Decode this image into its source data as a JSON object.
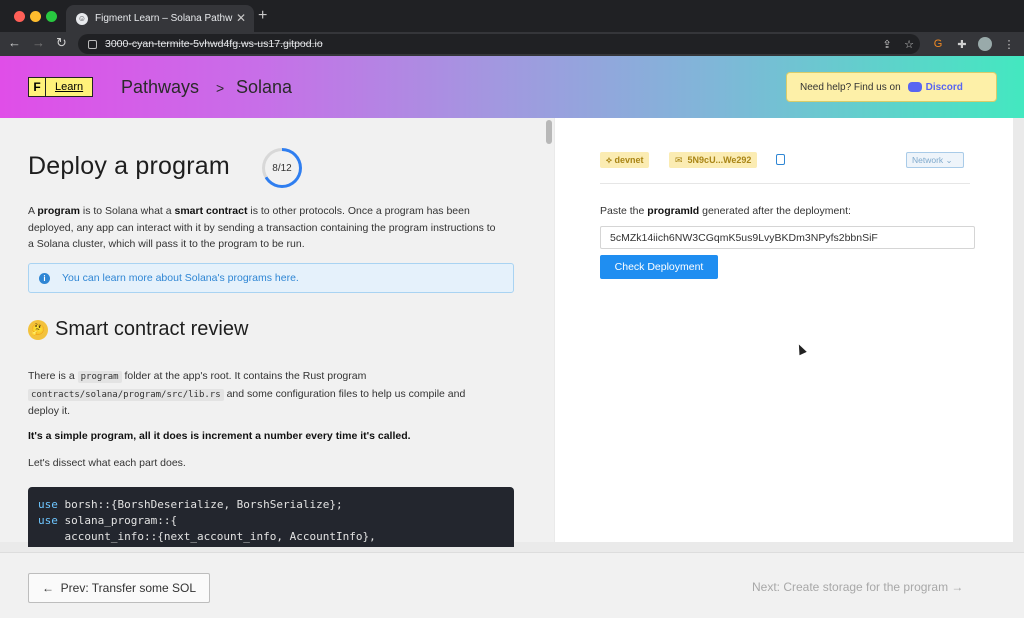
{
  "browser": {
    "tab_title": "Figment Learn – Solana Pathw",
    "url": "3000-cyan-termite-5vhwd4fg.ws-us17.gitpod.io"
  },
  "header": {
    "logo_letter": "F",
    "logo_text": "Learn",
    "breadcrumb": [
      "Pathways",
      ">",
      "Solana"
    ],
    "help_text": "Need help? Find us on",
    "discord_label": "Discord"
  },
  "main": {
    "title": "Deploy a program",
    "progress_label": "8/12",
    "progress_fraction": 0.667,
    "intro": {
      "p1_a": "A ",
      "p1_b": "program",
      "p1_c": " is to Solana what a ",
      "p1_d": "smart contract",
      "p1_e": " is to other protocols. Once a program has been deployed, any app can interact with it by sending a transaction containing the program instructions to a Solana cluster, which will pass it to the program to be run."
    },
    "info_text": "You can learn more about Solana's programs here.",
    "section_title": "Smart contract review",
    "section_p1_a": "There is a ",
    "section_p1_code1": "program",
    "section_p1_b": " folder at the app's root. It contains the Rust program",
    "section_p1_code2": "contracts/solana/program/src/lib.rs",
    "section_p1_c": " and some configuration files to help us compile and deploy it.",
    "section_p2": "It's a simple program, all it does is increment a number every time it's called.",
    "section_p3": "Let's dissect what each part does.",
    "code_lines": [
      "use borsh::{BorshDeserialize, BorshSerialize};",
      "use solana_program::{",
      "    account_info::{next_account_info, AccountInfo},"
    ]
  },
  "right": {
    "network_tag": "devnet",
    "account_tag": "5N9cU...We292",
    "network_select": "Network",
    "label_a": "Paste the ",
    "label_b": "programId",
    "label_c": " generated after the deployment:",
    "input_value": "5cMZk14iich6NW3CGqmK5us9LvyBKDm3NPyfs2bbnSiF",
    "button_label": "Check Deployment"
  },
  "footer": {
    "prev_label": "Prev: Transfer some SOL",
    "next_label": "Next: Create storage for the program"
  }
}
